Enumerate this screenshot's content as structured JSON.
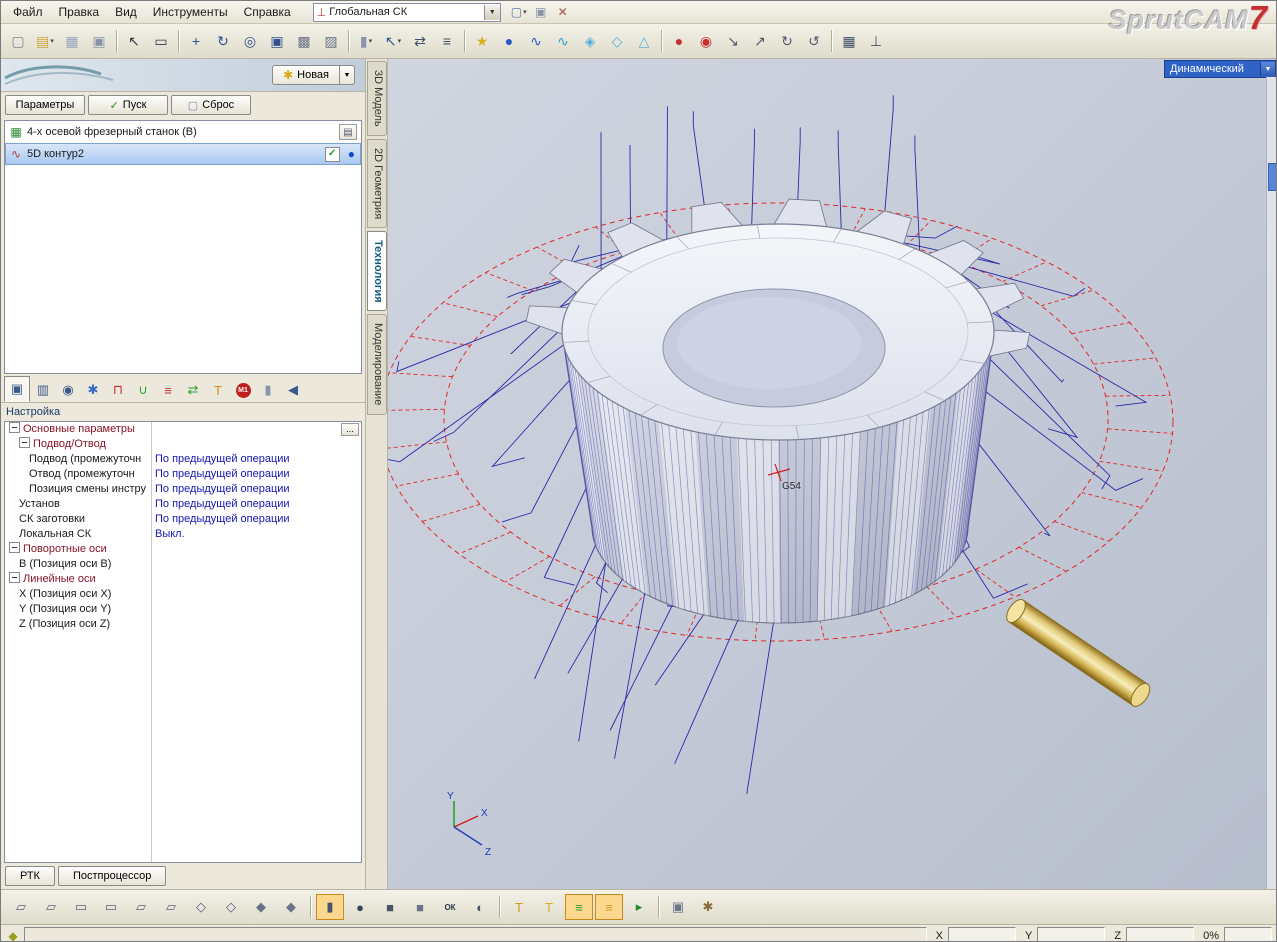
{
  "menubar": {
    "items": [
      "Файл",
      "Правка",
      "Вид",
      "Инструменты",
      "Справка"
    ],
    "cs_combo": {
      "value": "Глобальная СК"
    },
    "icons": [
      {
        "name": "new-project-icon",
        "glyph": "▢",
        "color": "#5a7aa8",
        "dropdown": true
      },
      {
        "name": "export-project-icon",
        "glyph": "▣",
        "color": "#8a94a8"
      },
      {
        "name": "delete-icon",
        "glyph": "✕",
        "color": "#b05050"
      }
    ],
    "logo": {
      "text": "SprutCAM",
      "version": "7"
    }
  },
  "toolbar": {
    "icons": [
      {
        "name": "new-file-icon",
        "glyph": "▢",
        "color": "#7a849a"
      },
      {
        "name": "open-import-icon",
        "glyph": "▤",
        "color": "#caa53a",
        "dropdown": true
      },
      {
        "name": "save-icon",
        "glyph": "▦",
        "color": "#9aa6bc"
      },
      {
        "name": "print-icon",
        "glyph": "▣",
        "color": "#8a94a8"
      },
      {
        "sep": true
      },
      {
        "name": "select-cursor-icon",
        "glyph": "↖",
        "color": "#303848"
      },
      {
        "name": "select-window-icon",
        "glyph": "▭",
        "color": "#303848"
      },
      {
        "sep": true
      },
      {
        "name": "pan-view-icon",
        "glyph": "+",
        "color": "#305090"
      },
      {
        "name": "rotate-view-icon",
        "glyph": "↻",
        "color": "#305090"
      },
      {
        "name": "zoom-icon",
        "glyph": "◎",
        "color": "#305090"
      },
      {
        "name": "zoom-window-icon",
        "glyph": "▣",
        "color": "#305090"
      },
      {
        "name": "snapshot-icon",
        "glyph": "▩",
        "color": "#6a7488"
      },
      {
        "name": "render-settings-icon",
        "glyph": "▨",
        "color": "#6a7488"
      },
      {
        "sep": true
      },
      {
        "name": "workpiece-mode-icon",
        "glyph": "▮",
        "color": "#8a94b0",
        "dropdown": true
      },
      {
        "name": "pick-filter-icon",
        "glyph": "↖",
        "color": "#305090",
        "dropdown": true
      },
      {
        "name": "transform-icon",
        "glyph": "⇄",
        "color": "#405068"
      },
      {
        "name": "calc-table-icon",
        "glyph": "≡",
        "color": "#405068"
      },
      {
        "sep": true
      },
      {
        "name": "new-group-icon",
        "glyph": "★",
        "color": "#d8b020"
      },
      {
        "name": "point-icon",
        "glyph": "●",
        "color": "#2858c8"
      },
      {
        "name": "curve-icon",
        "glyph": "∿",
        "color": "#2858c8"
      },
      {
        "name": "curve2-icon",
        "glyph": "∿",
        "color": "#28a0c8"
      },
      {
        "name": "surface-icon",
        "glyph": "◈",
        "color": "#58b0d8"
      },
      {
        "name": "solid-icon",
        "glyph": "◇",
        "color": "#58b0d8"
      },
      {
        "name": "mesh-icon",
        "glyph": "△",
        "color": "#58b0d8"
      },
      {
        "sep": true
      },
      {
        "name": "node-red-icon",
        "glyph": "●",
        "color": "#c83030"
      },
      {
        "name": "node-red2-icon",
        "glyph": "◉",
        "color": "#c83030"
      },
      {
        "name": "snap-move-icon",
        "glyph": "↘",
        "color": "#505a70"
      },
      {
        "name": "snap-move2-icon",
        "glyph": "↗",
        "color": "#505a70"
      },
      {
        "name": "rotate-cw-icon",
        "glyph": "↻",
        "color": "#505a70"
      },
      {
        "name": "rotate-ccw-icon",
        "glyph": "↺",
        "color": "#505a70"
      },
      {
        "sep": true
      },
      {
        "name": "grid-icon",
        "glyph": "▦",
        "color": "#405068"
      },
      {
        "name": "measure-icon",
        "glyph": "⊥",
        "color": "#405068"
      }
    ]
  },
  "left_panel": {
    "new_button": {
      "label": "Новая"
    },
    "action_buttons": [
      {
        "name": "parameters-button",
        "label": "Параметры",
        "glyph": "",
        "glyph_color": ""
      },
      {
        "name": "run-button",
        "label": "Пуск",
        "glyph": "✓",
        "glyph_color": "#1d9a1d"
      },
      {
        "name": "reset-button",
        "label": "Сброс",
        "glyph": "▢",
        "glyph_color": "#7a88b0"
      }
    ],
    "tree": {
      "machine": {
        "label": "4-х осевой фрезерный станок (B)"
      },
      "operation": {
        "label": "5D контур2"
      }
    },
    "tab_icons": [
      {
        "name": "setup-tab-icon",
        "glyph": "▣",
        "color": "#3a5a8a",
        "pressed": true
      },
      {
        "name": "job-assignment-tab-icon",
        "glyph": "▥",
        "color": "#3a5a8a"
      },
      {
        "name": "strategy-tab-icon",
        "glyph": "◉",
        "color": "#3a5a8a"
      },
      {
        "name": "options-tab-icon",
        "glyph": "✱",
        "color": "#3a6ac8"
      },
      {
        "name": "approach-tab-icon",
        "glyph": "⊓",
        "color": "#c03030"
      },
      {
        "name": "guard-tab-icon",
        "glyph": "∪",
        "color": "#30a030"
      },
      {
        "name": "levels-tab-icon",
        "glyph": "≡",
        "color": "#c03030"
      },
      {
        "name": "link-tab-icon",
        "glyph": "⇄",
        "color": "#30a030"
      },
      {
        "name": "tool-tab-icon",
        "glyph": "Т",
        "color": "#d09020"
      },
      {
        "name": "machining-codes-tab-icon",
        "glyph": "M1",
        "color": "#ffffff",
        "round": true
      },
      {
        "name": "holders-tab-icon",
        "glyph": "▮",
        "color": "#8a94a8"
      },
      {
        "name": "output-tab-icon",
        "glyph": "◀",
        "color": "#3a5a8a"
      }
    ],
    "settings_label": "Настройка",
    "more_button": "...",
    "params": [
      {
        "label": "Основные параметры",
        "value": "",
        "level": 0,
        "group": true,
        "expander": true,
        "more": true
      },
      {
        "label": "Подвод/Отвод",
        "value": "",
        "level": 1,
        "group": true,
        "expander": true
      },
      {
        "label": "Подвод (промежуточн",
        "value": "По предыдущей операции",
        "level": 2
      },
      {
        "label": "Отвод (промежуточн",
        "value": "По предыдущей операции",
        "level": 2
      },
      {
        "label": "Позиция смены инстру",
        "value": "По предыдущей операции",
        "level": 2
      },
      {
        "label": "Установ",
        "value": "По предыдущей операции",
        "level": 1
      },
      {
        "label": "СК заготовки",
        "value": "По предыдущей операции",
        "level": 1
      },
      {
        "label": "Локальная СК",
        "value": "Выкл.",
        "level": 1
      },
      {
        "label": "Поворотные оси",
        "value": "",
        "level": 0,
        "group": true,
        "expander": true
      },
      {
        "label": "B (Позиция оси B)",
        "value": "",
        "level": 1
      },
      {
        "label": "Линейные оси",
        "value": "",
        "level": 0,
        "group": true,
        "expander": true
      },
      {
        "label": "X (Позиция оси X)",
        "value": "",
        "level": 1
      },
      {
        "label": "Y (Позиция оси Y)",
        "value": "",
        "level": 1
      },
      {
        "label": "Z (Позиция оси Z)",
        "value": "",
        "level": 1
      }
    ],
    "bottom_buttons": [
      {
        "name": "rtk-button",
        "label": "РТК"
      },
      {
        "name": "postprocessor-button",
        "label": "Постпроцессор"
      }
    ]
  },
  "side_tabs": {
    "items": [
      "3D Модель",
      "2D Геометрия",
      "Технология",
      "Моделирование"
    ],
    "active": "Технология"
  },
  "viewport": {
    "view_mode": "Динамический",
    "wcs_label": "G54",
    "axis_labels": {
      "x": "X",
      "y": "Y",
      "z": "Z"
    }
  },
  "bottom_toolbar": {
    "icons": [
      {
        "name": "stock-plane-icon",
        "glyph": "▱",
        "color": "#5a6478"
      },
      {
        "name": "stock-plane2-icon",
        "glyph": "▱",
        "color": "#5a6478"
      },
      {
        "name": "stock-profile-icon",
        "glyph": "▭",
        "color": "#5a6478"
      },
      {
        "name": "stock-profile2-icon",
        "glyph": "▭",
        "color": "#5a6478"
      },
      {
        "name": "stock-sheet-icon",
        "glyph": "▱",
        "color": "#5a6478"
      },
      {
        "name": "stock-sheet2-icon",
        "glyph": "▱",
        "color": "#5a6478"
      },
      {
        "name": "stock-wire-box-icon",
        "glyph": "◇",
        "color": "#5a6478"
      },
      {
        "name": "stock-wire-box2-icon",
        "glyph": "◇",
        "color": "#5a6478"
      },
      {
        "name": "stock-solid-box-icon",
        "glyph": "◆",
        "color": "#6a7488"
      },
      {
        "name": "stock-solid-box2-icon",
        "glyph": "◆",
        "color": "#6a7488"
      },
      {
        "sep": true
      },
      {
        "name": "sim-stock-icon",
        "glyph": "▮",
        "color": "#4a5468",
        "pressed": true
      },
      {
        "name": "sim-part-icon",
        "glyph": "●",
        "color": "#3a4458"
      },
      {
        "name": "sim-fixture-icon",
        "glyph": "■",
        "color": "#4a5468"
      },
      {
        "name": "sim-machine-icon",
        "glyph": "■",
        "color": "#6a7488"
      },
      {
        "name": "sim-result-ok-icon",
        "glyph": "ОК",
        "color": "#2a3448",
        "small": true
      },
      {
        "name": "sim-compare-icon",
        "glyph": "◐",
        "color": "#4a5468"
      },
      {
        "sep": true
      },
      {
        "name": "tool-with-holder-icon",
        "glyph": "T",
        "color": "#d49a1a"
      },
      {
        "name": "tool-only-icon",
        "glyph": "T",
        "color": "#d4b01a"
      },
      {
        "name": "toolpath-visible-icon",
        "glyph": "≡",
        "color": "#3a9a3a",
        "pressed": true
      },
      {
        "name": "toolpath-points-icon",
        "glyph": "≡",
        "color": "#c8a020",
        "pressed": true
      },
      {
        "name": "operation-tree-icon",
        "glyph": "▸",
        "color": "#2a8a2a"
      },
      {
        "sep": true
      },
      {
        "name": "machine-head-icon",
        "glyph": "▣",
        "color": "#6a7488"
      },
      {
        "name": "setup-tools-icon",
        "glyph": "✱",
        "color": "#8a6a3a"
      }
    ]
  },
  "statusbar": {
    "fields": [
      {
        "label": "X",
        "value": ""
      },
      {
        "label": "Y",
        "value": ""
      },
      {
        "label": "Z",
        "value": ""
      }
    ],
    "progress": "0%"
  }
}
